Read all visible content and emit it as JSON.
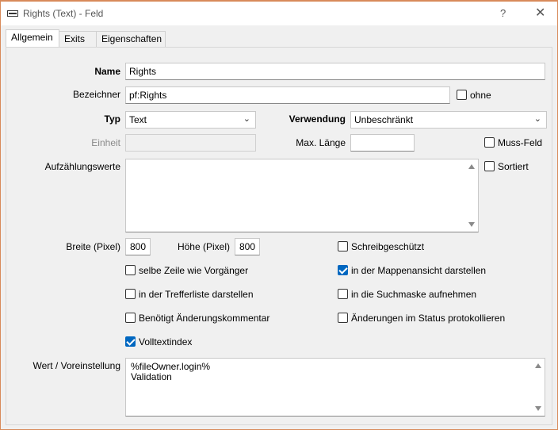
{
  "window": {
    "title": "Rights (Text) - Feld",
    "help": "?",
    "close": "✕"
  },
  "tabs": [
    {
      "label": "Allgemein",
      "active": true
    },
    {
      "label": "Exits",
      "active": false
    },
    {
      "label": "Eigenschaften",
      "active": false
    }
  ],
  "form": {
    "name_label": "Name",
    "name_value": "Rights",
    "bezeichner_label": "Bezeichner",
    "bezeichner_value": "pf:Rights",
    "ohne_label": "ohne",
    "typ_label": "Typ",
    "typ_value": "Text",
    "verwendung_label": "Verwendung",
    "verwendung_value": "Unbeschränkt",
    "einheit_label": "Einheit",
    "einheit_value": "",
    "maxlaenge_label": "Max. Länge",
    "maxlaenge_value": "",
    "mussfeld_label": "Muss-Feld",
    "aufzaehlung_label": "Aufzählungswerte",
    "aufzaehlung_value": "",
    "sortiert_label": "Sortiert",
    "breite_label": "Breite (Pixel)",
    "breite_value": "800",
    "hoehe_label": "Höhe (Pixel)",
    "hoehe_value": "800",
    "schreibgeschuetzt_label": "Schreibgeschützt",
    "selbe_zeile_label": "selbe Zeile wie Vorgänger",
    "mappenansicht_label": "in der Mappenansicht darstellen",
    "trefferliste_label": "in der Trefferliste darstellen",
    "suchmaske_label": "in die Suchmaske aufnehmen",
    "aenderungskommentar_label": "Benötigt Änderungskommentar",
    "status_protokoll_label": "Änderungen im Status protokollieren",
    "volltextindex_label": "Volltextindex",
    "wert_label": "Wert / Voreinstellung",
    "wert_line1": "%fileOwner.login%",
    "wert_line2": "Validation"
  },
  "checkboxes": {
    "ohne": false,
    "mussfeld": false,
    "sortiert": false,
    "schreibgeschuetzt": false,
    "selbe_zeile": false,
    "mappenansicht": true,
    "trefferliste": false,
    "suchmaske": false,
    "aenderungskommentar": false,
    "status_protokoll": false,
    "volltextindex": true
  },
  "colors": {
    "accent": "#0067c0",
    "window_border": "#d88a5a"
  }
}
